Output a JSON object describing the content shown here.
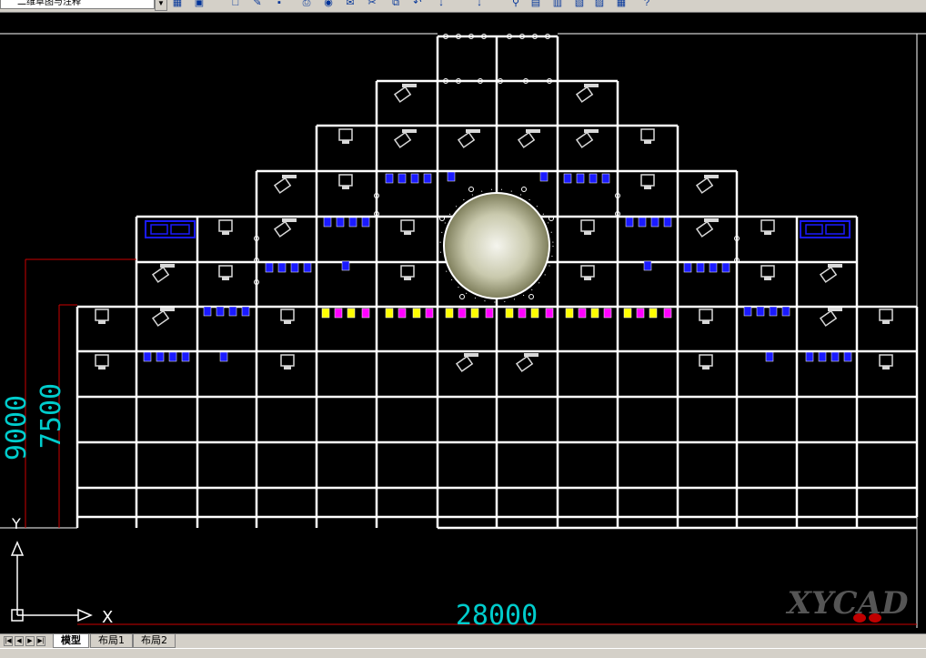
{
  "toolbar": {
    "workspace_selector": "二维草图与注释",
    "icons": [
      "zoom-icon",
      "plot-icon",
      "new-icon",
      "open-icon",
      "save-icon",
      "print-icon",
      "preview-icon",
      "publish-icon",
      "cut-icon",
      "copy-icon",
      "undo-icon",
      "redo-icon",
      "pan-icon",
      "zoom-window-icon",
      "properties-icon",
      "design-center-icon",
      "tool-palette-icon",
      "sheet-set-icon",
      "markup-icon",
      "calc-icon",
      "help-icon"
    ]
  },
  "drawing": {
    "dimensions": {
      "height_outer": "9000",
      "height_inner": "7500",
      "width": "28000"
    },
    "ucs": {
      "x_label": "X",
      "y_label": "Y"
    },
    "watermark": "XYCAD",
    "colors": {
      "background": "#000000",
      "truss": "#ffffff",
      "dimension_text": "#00cccc",
      "dimension_line": "#cc0000",
      "par_blue": "#1a1aff",
      "par_yellow": "#ffff00",
      "par_magenta": "#ff00ff",
      "moving_head": "#d8d8d8",
      "moon": "#c8c8a8"
    }
  },
  "tabs": [
    {
      "label": "模型",
      "active": true
    },
    {
      "label": "布局1",
      "active": false
    },
    {
      "label": "布局2",
      "active": false
    }
  ]
}
